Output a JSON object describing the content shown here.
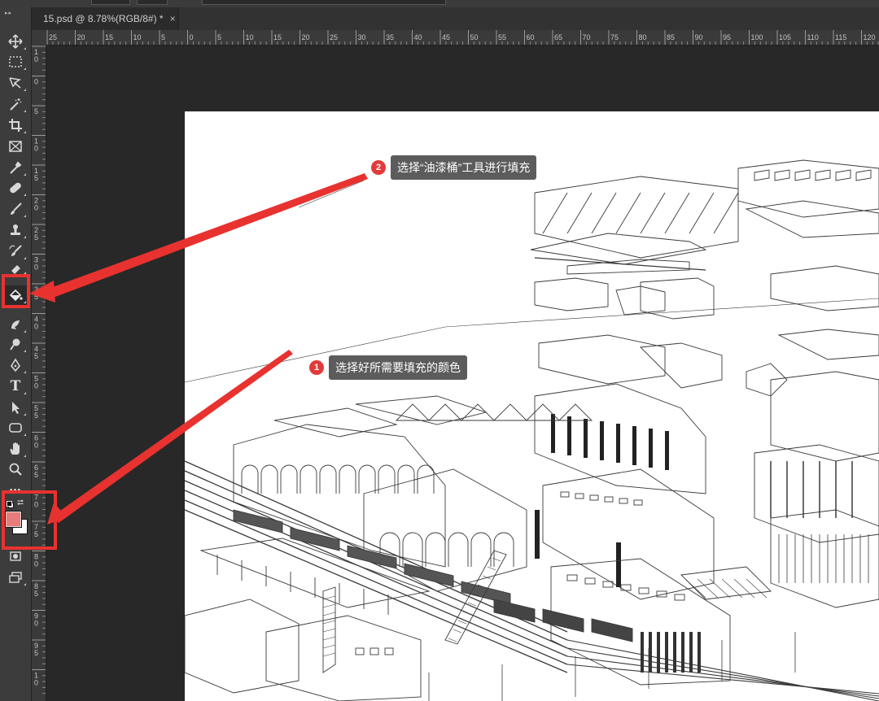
{
  "document_tab": {
    "title": "15.psd @ 8.78%(RGB/8#) *",
    "close_glyph": "×"
  },
  "rulers": {
    "horizontal_labels": [
      "25",
      "20",
      "15",
      "10",
      "5",
      "0",
      "5",
      "10",
      "15",
      "20",
      "25",
      "30",
      "35",
      "40",
      "45",
      "50",
      "55",
      "60",
      "65",
      "70",
      "75",
      "80",
      "85",
      "90",
      "95",
      "100",
      "105",
      "110",
      "115",
      "120"
    ],
    "vertical_labels": [
      "1 0",
      "0",
      "5",
      "1 0",
      "1 5",
      "2 0",
      "2 5",
      "3 0",
      "3 5",
      "4 0",
      "4 5",
      "5 0",
      "5 5",
      "6 0",
      "6 5",
      "7 0",
      "7 5",
      "8 0",
      "8 5",
      "9 0",
      "9 5",
      "1 0"
    ]
  },
  "toolbar": {
    "tools": [
      "move-tool",
      "marquee-tool",
      "lasso-tool",
      "magic-wand-tool",
      "crop-tool",
      "frame-tool",
      "eyedropper-tool",
      "healing-brush-tool",
      "brush-tool",
      "clone-stamp-tool",
      "history-brush-tool",
      "eraser-tool",
      "paint-bucket-tool",
      "smudge-tool",
      "dodge-tool",
      "pen-tool",
      "type-tool",
      "path-selection-tool",
      "rectangle-tool",
      "hand-tool",
      "zoom-tool",
      "more-tools"
    ],
    "type_tool_glyph": "T",
    "more_glyph": "•••",
    "foreground_color": "#e87c7c",
    "background_color": "#ffffff",
    "active_tool": "paint-bucket-tool"
  },
  "annotations": [
    {
      "number": "1",
      "text": "选择好所需要填充的颜色"
    },
    {
      "number": "2",
      "text": "选择“油漆桶”工具进行填充"
    }
  ],
  "accent_color": "#e8322f"
}
